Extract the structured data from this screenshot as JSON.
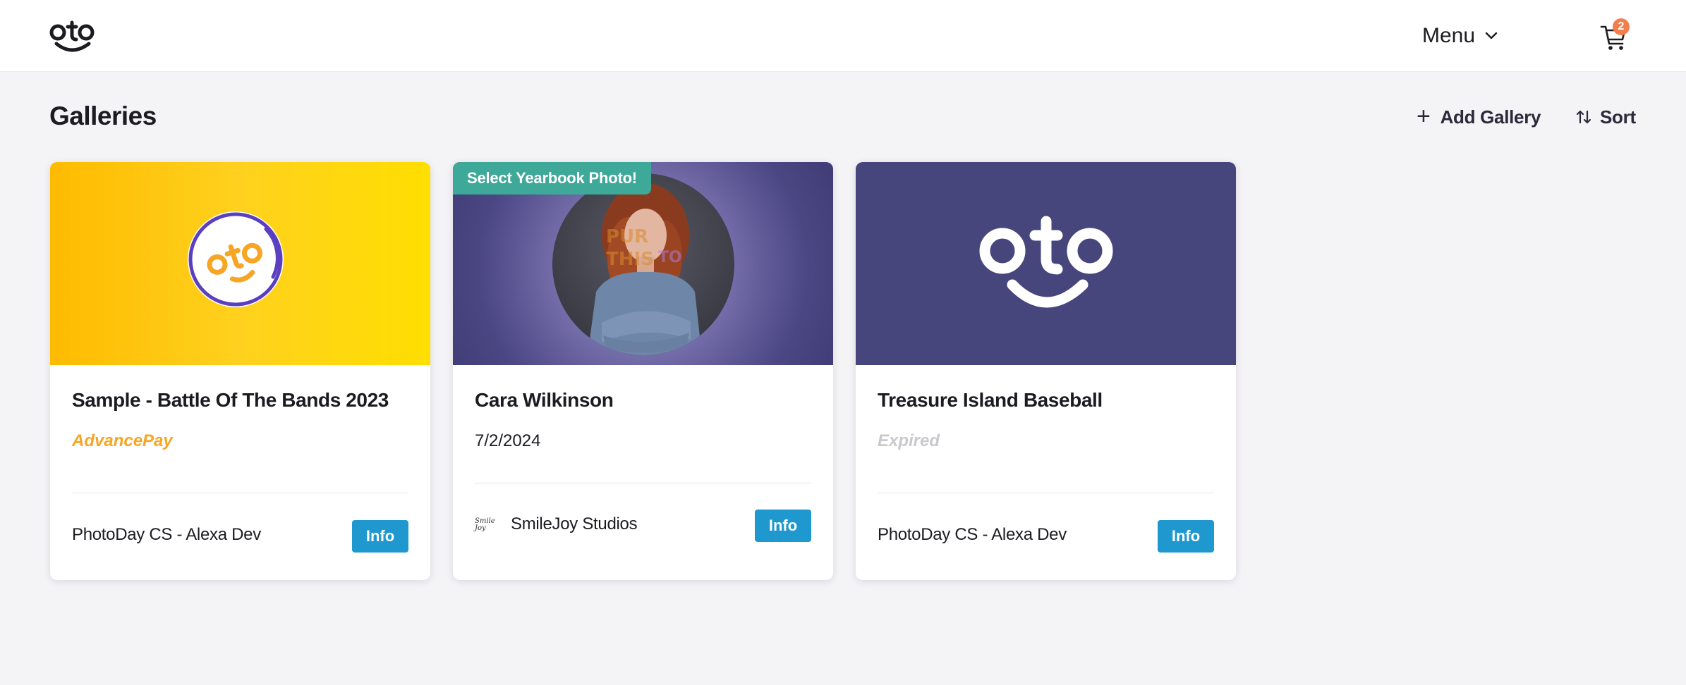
{
  "header": {
    "logo_text": "oto",
    "menu_label": "Menu",
    "cart_count": "2"
  },
  "page": {
    "title": "Galleries",
    "add_gallery_label": "Add Gallery",
    "sort_label": "Sort"
  },
  "galleries": [
    {
      "title": "Sample - Battle Of The Bands 2023",
      "subtitle": "AdvancePay",
      "footer": "PhotoDay CS - Alexa Dev",
      "info_label": "Info",
      "image_icon": "oto-circle-logo"
    },
    {
      "title": "Cara Wilkinson",
      "subtitle": "7/2/2024",
      "ribbon": "Select Yearbook Photo!",
      "footer": "SmileJoy Studios",
      "studio_logo": "Smile Joy",
      "info_label": "Info",
      "image_icon": "portrait-photo"
    },
    {
      "title": "Treasure Island Baseball",
      "subtitle": "Expired",
      "footer": "PhotoDay CS - Alexa Dev",
      "info_label": "Info",
      "image_icon": "oto-logo"
    }
  ],
  "colors": {
    "accent_blue": "#1e98cf",
    "advancepay_orange": "#f6a524",
    "ribbon_green": "#3ea899",
    "brand_purple": "#46457c",
    "badge_orange": "#f07f4d"
  }
}
